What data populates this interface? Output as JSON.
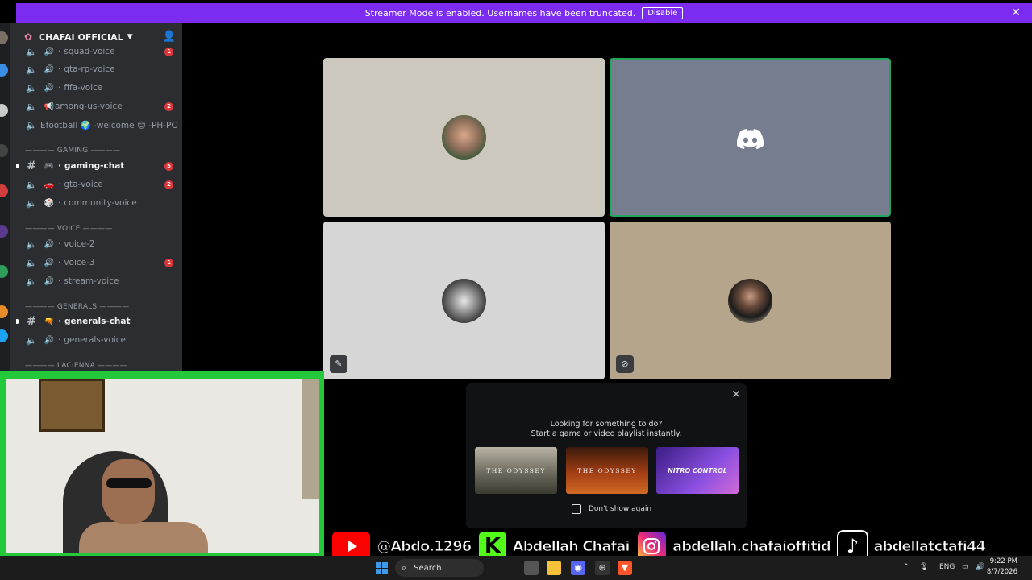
{
  "banner": {
    "message": "Streamer Mode is enabled. Usernames have been truncated.",
    "disable_label": "Disable"
  },
  "server": {
    "name": "CHAFAI OFFICIAL"
  },
  "channels": [
    {
      "name": "squad-voice",
      "kind": "voice",
      "emoji": "🔊",
      "badge": "1"
    },
    {
      "name": "gta-rp-voice",
      "kind": "voice",
      "emoji": "🔊",
      "badge": ""
    },
    {
      "name": "fifa-voice",
      "kind": "voice",
      "emoji": "🔊",
      "badge": ""
    },
    {
      "name": "among-us-voice",
      "kind": "voice",
      "emoji": "📢",
      "badge": "2"
    },
    {
      "name": "Efootball 🌍 -welcome 😊 -PH-PC",
      "kind": "voice",
      "emoji": "",
      "badge": ""
    },
    {
      "name": "gaming-chat",
      "kind": "text",
      "emoji": "🎮",
      "badge": "5"
    },
    {
      "name": "gta-voice",
      "kind": "voice",
      "emoji": "🚗",
      "badge": "2"
    },
    {
      "name": "community-voice",
      "kind": "voice",
      "emoji": "🎲",
      "badge": ""
    },
    {
      "name": "voice-2",
      "kind": "voice",
      "emoji": "🔊",
      "badge": ""
    },
    {
      "name": "voice-3",
      "kind": "voice",
      "emoji": "🔊",
      "badge": "1"
    },
    {
      "name": "stream-voice",
      "kind": "voice",
      "emoji": "🔊",
      "badge": ""
    },
    {
      "name": "generals-chat",
      "kind": "text",
      "emoji": "🔫",
      "badge": ""
    },
    {
      "name": "generals-voice",
      "kind": "voice",
      "emoji": "🔊",
      "badge": ""
    }
  ],
  "categories": {
    "gaming": "———— GAMING ————",
    "voice": "———— VOICE ————",
    "generals": "———— GENERALS ————",
    "lacienna": "———— LACIENNA ————"
  },
  "activity": {
    "line1": "Looking for something to do?",
    "line2": "Start a game or video playlist instantly.",
    "games": [
      "THE ODYSSEY",
      "THE ODYSSEY",
      "NITRO CONTROL"
    ],
    "dont_show": "Don't show again"
  },
  "socials": {
    "youtube": "@Abdo.1296",
    "kick": "Abdellah Chafai",
    "instagram": "abdellah.chafaioffitid",
    "tiktok": "abdellatctafi44"
  },
  "taskbar": {
    "search_placeholder": "Search",
    "lang": "ENG",
    "time": "9:22 PM",
    "date": "8/7/2026"
  },
  "colors": {
    "banner": "#7b2cf0",
    "sidebar": "#2b2d31",
    "speaking_border": "#23a55a",
    "badge": "#da373c",
    "webcam_frame": "#23c93b"
  }
}
